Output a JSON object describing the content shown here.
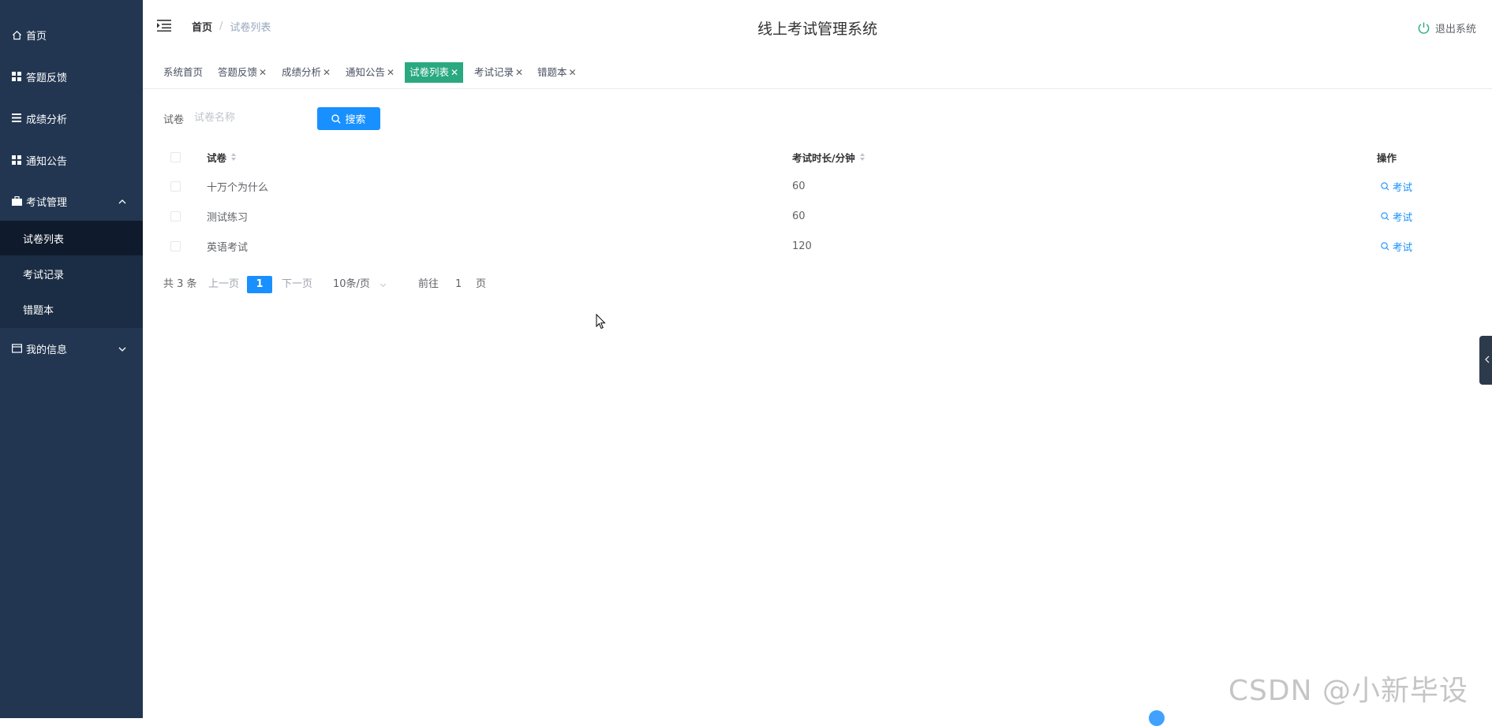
{
  "sidebar": {
    "items": [
      {
        "label": "首页",
        "icon": "home-icon"
      },
      {
        "label": "答题反馈",
        "icon": "grid-icon"
      },
      {
        "label": "成绩分析",
        "icon": "list-icon"
      },
      {
        "label": "通知公告",
        "icon": "grid-icon"
      },
      {
        "label": "考试管理",
        "icon": "briefcase-icon",
        "expanded": true
      },
      {
        "label": "我的信息",
        "icon": "id-card-icon",
        "expanded": false
      }
    ],
    "submenu": [
      {
        "label": "试卷列表",
        "active": true
      },
      {
        "label": "考试记录"
      },
      {
        "label": "错题本"
      }
    ]
  },
  "header": {
    "breadcrumb_home": "首页",
    "breadcrumb_sep": "/",
    "breadcrumb_current": "试卷列表",
    "title": "线上考试管理系统",
    "logout": "退出系统"
  },
  "tags": [
    {
      "label": "系统首页",
      "closable": false
    },
    {
      "label": "答题反馈",
      "closable": true
    },
    {
      "label": "成绩分析",
      "closable": true
    },
    {
      "label": "通知公告",
      "closable": true
    },
    {
      "label": "试卷列表",
      "closable": true,
      "active": true
    },
    {
      "label": "考试记录",
      "closable": true
    },
    {
      "label": "错题本",
      "closable": true
    }
  ],
  "search": {
    "label": "试卷",
    "placeholder": "试卷名称",
    "value": "",
    "button": "搜索"
  },
  "table": {
    "headers": {
      "paper": "试卷",
      "duration": "考试时长/分钟",
      "ops": "操作"
    },
    "rows": [
      {
        "paper": "十万个为什么",
        "duration": "60",
        "op": "考试"
      },
      {
        "paper": "测试练习",
        "duration": "60",
        "op": "考试"
      },
      {
        "paper": "英语考试",
        "duration": "120",
        "op": "考试"
      }
    ]
  },
  "pagination": {
    "total": "共 3 条",
    "prev": "上一页",
    "current": "1",
    "next": "下一页",
    "page_size": "10条/页",
    "goto_label": "前往",
    "goto_value": "1",
    "goto_suffix": "页"
  },
  "watermark": "CSDN @小新毕设",
  "colors": {
    "sidebar_bg": "#223651",
    "active_tag": "#2aa981",
    "primary": "#1890ff"
  }
}
